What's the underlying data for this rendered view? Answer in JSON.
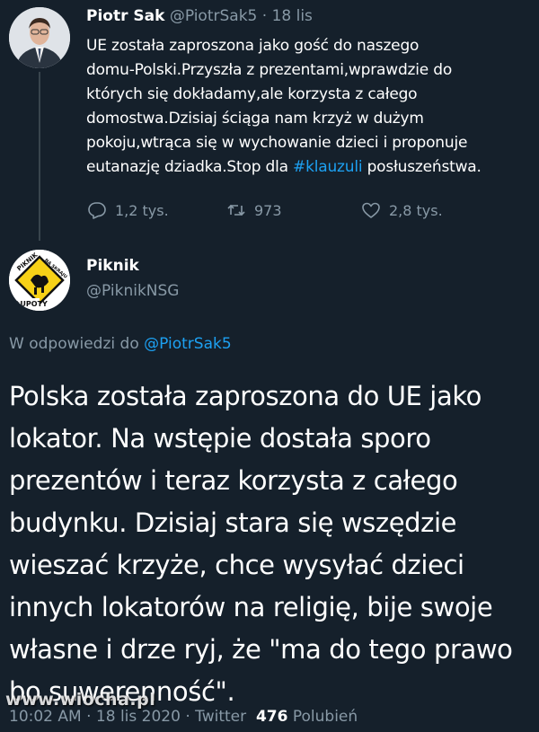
{
  "parent_tweet": {
    "name": "Piotr Sak",
    "handle": "@PiotrSak5",
    "separator": "·",
    "time": "18 lis",
    "text_lines": [
      "UE została zaproszona jako gość do naszego",
      "domu-Polski.Przyszła z prezentami,wprawdzie do",
      "których się dokładamy,ale korzysta z całego",
      "domostwa.Dzisiaj ściąga nam krzyż w dużym",
      "pokoju,wtrąca się w wychowanie dzieci i proponuje"
    ],
    "last_line_before": "eutanazję dziadka.Stop dla ",
    "hashtag": "#klauzuli",
    "last_line_after": " posłuszeństwa.",
    "replies": "1,2 tys.",
    "retweets": "973",
    "likes": "2,8 tys."
  },
  "reply_tweet": {
    "name": "Piknik",
    "handle": "@PiknikNSG",
    "avatar_text_top": "PIKNIK",
    "avatar_text_side": "NA SKRAJU",
    "avatar_text_bottom": "GŁUPOTY",
    "reply_to_label": "W odpowiedzi do ",
    "reply_to_handle": "@PiotrSak5",
    "text_lines": [
      "Polska została zaproszona do UE jako",
      "lokator. Na wstępie dostała sporo",
      "prezentów i teraz korzysta z całego",
      "budynku. Dzisiaj stara się wszędzie",
      "wieszać krzyże, chce wysyłać dzieci",
      "innych lokatorów na religię, bije swoje",
      "własne i drze ryj, że \"ma do tego prawo",
      "bo suwerenność\"."
    ],
    "time": "10:02 AM",
    "date": "18 lis 2020",
    "source": "Twitter",
    "likes_count": "476",
    "likes_label": "Polubień",
    "separator": "·"
  },
  "watermark": "www.wiocha.pl",
  "colors": {
    "background": "#15202b",
    "text": "#ffffff",
    "muted": "#8899a6",
    "link": "#1da1f2"
  }
}
